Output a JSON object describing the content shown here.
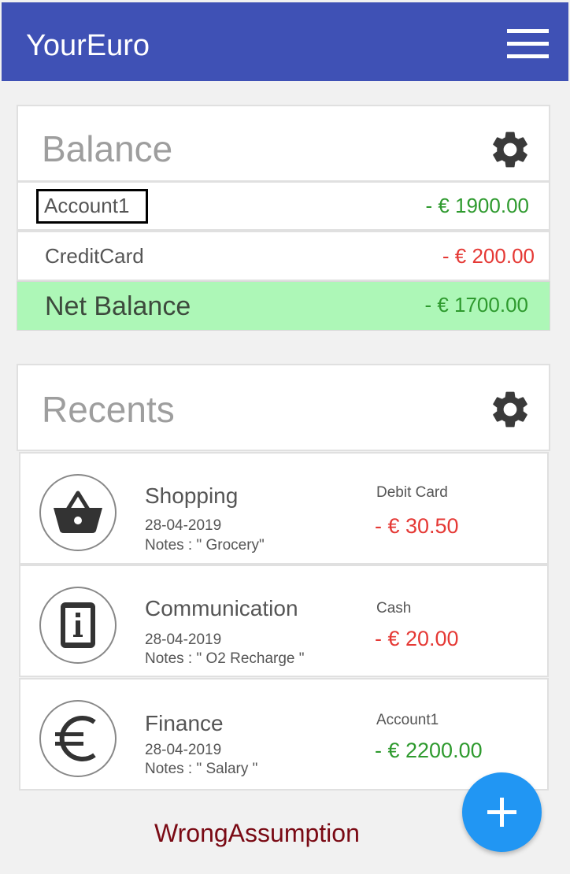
{
  "app": {
    "title": "YourEuro"
  },
  "balance": {
    "title": "Balance",
    "accounts": [
      {
        "name": "Account1",
        "amount": "- € 1900.00",
        "status": "positive"
      },
      {
        "name": "CreditCard",
        "amount": "- € 200.00",
        "status": "negative"
      }
    ],
    "net": {
      "label": "Net Balance",
      "amount": "- € 1700.00"
    }
  },
  "recents": {
    "title": "Recents",
    "items": [
      {
        "category": "Shopping",
        "icon": "shopping-basket-icon",
        "date": "28-04-2019",
        "notes": "Notes : \" Grocery\"",
        "account": "Debit Card",
        "amount": "- € 30.50",
        "status": "negative"
      },
      {
        "category": "Communication",
        "icon": "mobile-info-icon",
        "date": "28-04-2019",
        "notes": "Notes : \" O2 Recharge  \"",
        "account": "Cash",
        "amount": "- € 20.00",
        "status": "negative"
      },
      {
        "category": "Finance",
        "icon": "euro-icon",
        "date": "28-04-2019",
        "notes": "Notes : \" Salary  \"",
        "account": "Account1",
        "amount": "- € 2200.00",
        "status": "positive"
      }
    ]
  },
  "caption": "WrongAssumption",
  "colors": {
    "app_bar": "#3f51b5",
    "positive": "#2e9a2e",
    "negative": "#e53935",
    "net_highlight": "#adf7b7",
    "fab": "#2196f3",
    "caption": "#7a0a14"
  },
  "icons": {
    "menu": "hamburger-menu-icon",
    "settings": "gear-icon",
    "add": "plus-icon"
  }
}
